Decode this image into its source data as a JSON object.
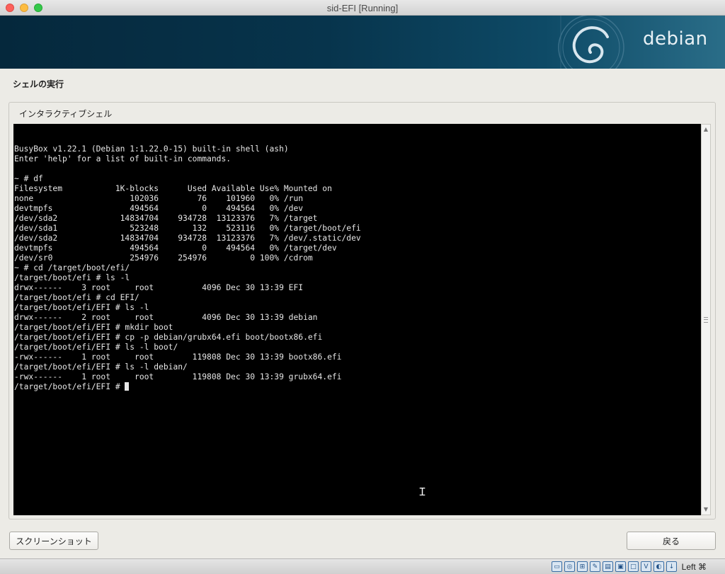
{
  "window": {
    "title": "sid-EFI [Running]"
  },
  "banner": {
    "logo_text": "debian"
  },
  "page": {
    "title": "シェルの実行",
    "group_title": "インタラクティブシェル"
  },
  "terminal": {
    "lines": [
      "BusyBox v1.22.1 (Debian 1:1.22.0-15) built-in shell (ash)",
      "Enter 'help' for a list of built-in commands.",
      "",
      "~ # df",
      "Filesystem           1K-blocks      Used Available Use% Mounted on",
      "none                    102036        76    101960   0% /run",
      "devtmpfs                494564         0    494564   0% /dev",
      "/dev/sda2             14834704    934728  13123376   7% /target",
      "/dev/sda1               523248       132    523116   0% /target/boot/efi",
      "/dev/sda2             14834704    934728  13123376   7% /dev/.static/dev",
      "devtmpfs                494564         0    494564   0% /target/dev",
      "/dev/sr0                254976    254976         0 100% /cdrom",
      "~ # cd /target/boot/efi/",
      "/target/boot/efi # ls -l",
      "drwx------    3 root     root          4096 Dec 30 13:39 EFI",
      "/target/boot/efi # cd EFI/",
      "/target/boot/efi/EFI # ls -l",
      "drwx------    2 root     root          4096 Dec 30 13:39 debian",
      "/target/boot/efi/EFI # mkdir boot",
      "/target/boot/efi/EFI # cp -p debian/grubx64.efi boot/bootx86.efi",
      "/target/boot/efi/EFI # ls -l boot/",
      "-rwx------    1 root     root        119808 Dec 30 13:39 bootx86.efi",
      "/target/boot/efi/EFI # ls -l debian/",
      "-rwx------    1 root     root        119808 Dec 30 13:39 grubx64.efi"
    ],
    "prompt": "/target/boot/efi/EFI # "
  },
  "buttons": {
    "screenshot": "スクリーンショット",
    "back": "戻る"
  },
  "statusbar": {
    "icons": [
      "hard-disk-icon",
      "optical-disk-icon",
      "network-icon",
      "pencil-icon",
      "folder-icon",
      "display-icon",
      "monitor-icon",
      "virtualbox-icon",
      "mouse-icon",
      "download-arrow-icon"
    ],
    "host_key": "Left ⌘"
  }
}
